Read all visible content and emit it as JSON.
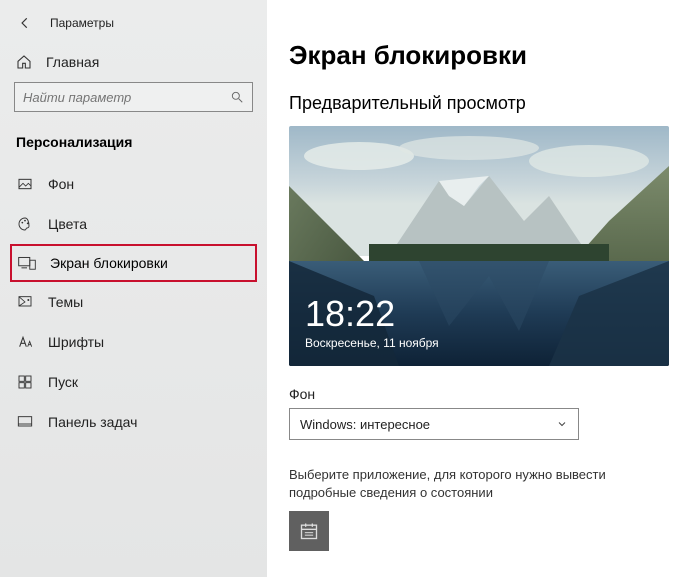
{
  "window_title": "Параметры",
  "home_label": "Главная",
  "search_placeholder": "Найти параметр",
  "section_label": "Персонализация",
  "nav": [
    {
      "label": "Фон"
    },
    {
      "label": "Цвета"
    },
    {
      "label": "Экран блокировки"
    },
    {
      "label": "Темы"
    },
    {
      "label": "Шрифты"
    },
    {
      "label": "Пуск"
    },
    {
      "label": "Панель задач"
    }
  ],
  "page_title": "Экран блокировки",
  "preview_heading": "Предварительный просмотр",
  "preview_time": "18:22",
  "preview_date": "Воскресенье, 11 ноября",
  "background_label": "Фон",
  "background_value": "Windows: интересное",
  "app_desc": "Выберите приложение, для которого нужно вывести подробные сведения о состоянии"
}
